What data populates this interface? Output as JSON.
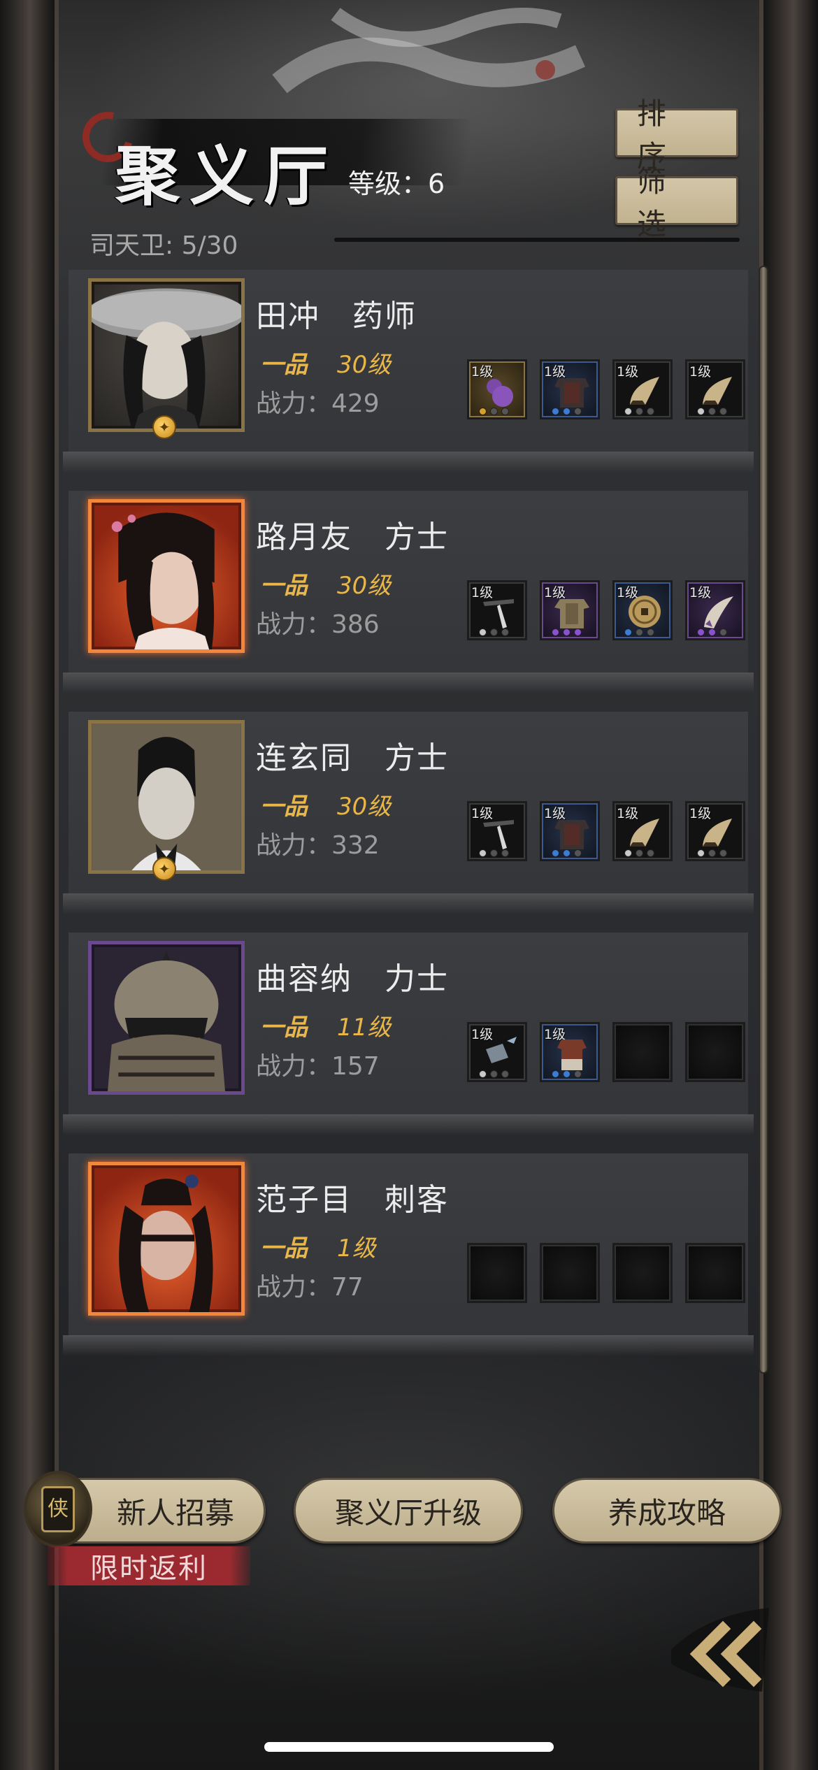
{
  "header": {
    "title": "聚义厅",
    "level_label": "等级：6",
    "guard_count": "司天卫: 5/30",
    "sort_button": "排序",
    "filter_button": "筛选"
  },
  "heroes": [
    {
      "name": "田冲　药师",
      "grade": "一品",
      "level": "30级",
      "power": "战力：429",
      "portrait_frame": "gold",
      "equipment": [
        {
          "level": "1级",
          "icon": "purple-gourd-icon",
          "rarity": "gold"
        },
        {
          "level": "1级",
          "icon": "armor-icon",
          "rarity": "blue"
        },
        {
          "level": "1级",
          "icon": "horn-icon",
          "rarity": "white"
        },
        {
          "level": "1级",
          "icon": "horn-icon",
          "rarity": "white"
        }
      ]
    },
    {
      "name": "路月友　方士",
      "grade": "一品",
      "level": "30级",
      "power": "战力：386",
      "portrait_frame": "orange",
      "equipment": [
        {
          "level": "1级",
          "icon": "staff-icon",
          "rarity": "white"
        },
        {
          "level": "1级",
          "icon": "robe-icon",
          "rarity": "purple"
        },
        {
          "level": "1级",
          "icon": "coin-icon",
          "rarity": "blue"
        },
        {
          "level": "1级",
          "icon": "claw-icon",
          "rarity": "purple"
        }
      ]
    },
    {
      "name": "连玄同　方士",
      "grade": "一品",
      "level": "30级",
      "power": "战力：332",
      "portrait_frame": "gold",
      "equipment": [
        {
          "level": "1级",
          "icon": "staff-icon",
          "rarity": "white"
        },
        {
          "level": "1级",
          "icon": "armor-icon",
          "rarity": "blue"
        },
        {
          "level": "1级",
          "icon": "horn-icon",
          "rarity": "white"
        },
        {
          "level": "1级",
          "icon": "horn-icon",
          "rarity": "white"
        }
      ]
    },
    {
      "name": "曲容纳　力士",
      "grade": "一品",
      "level": "11级",
      "power": "战力：157",
      "portrait_frame": "purple",
      "equipment": [
        {
          "level": "1级",
          "icon": "hammer-icon",
          "rarity": "white"
        },
        {
          "level": "1级",
          "icon": "vest-icon",
          "rarity": "blue"
        },
        {
          "level": "",
          "icon": "empty-slot",
          "rarity": "empty"
        },
        {
          "level": "",
          "icon": "empty-slot",
          "rarity": "empty"
        }
      ]
    },
    {
      "name": "范子目　刺客",
      "grade": "一品",
      "level": "1级",
      "power": "战力：77",
      "portrait_frame": "orange",
      "equipment": [
        {
          "level": "",
          "icon": "empty-slot",
          "rarity": "empty"
        },
        {
          "level": "",
          "icon": "empty-slot",
          "rarity": "empty"
        },
        {
          "level": "",
          "icon": "empty-slot",
          "rarity": "empty"
        },
        {
          "level": "",
          "icon": "empty-slot",
          "rarity": "empty"
        }
      ]
    }
  ],
  "bottom": {
    "recruit_button": "新人招募",
    "upgrade_button": "聚义厅升级",
    "guide_button": "养成攻略",
    "limited_banner": "限时返利",
    "back_icon": "double-chevron-left-icon"
  },
  "colors": {
    "gold_text": "#e9b64a",
    "button_bg": "#cfc2a2",
    "orange_frame": "#f0873a",
    "purple_frame": "#6a4a8c",
    "banner_red": "#9a2a30"
  }
}
